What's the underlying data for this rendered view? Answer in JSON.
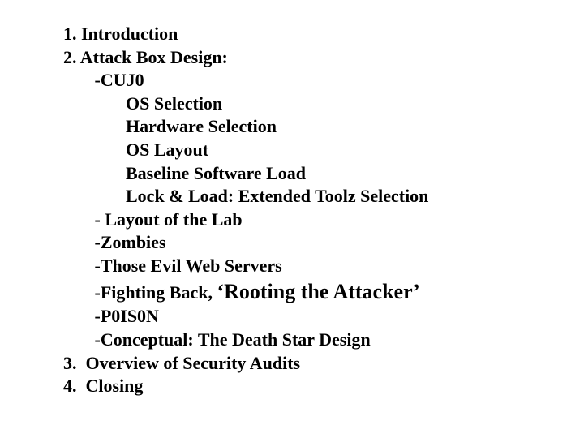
{
  "outline": {
    "item1": "1. Introduction",
    "item2": "2. Attack Box Design:",
    "cuj0": "-CUJ0",
    "os_selection": "OS Selection",
    "hardware_selection": "Hardware Selection",
    "os_layout": "OS Layout",
    "baseline_software_load": "Baseline Software Load",
    "lock_and_load": "Lock & Load: Extended Toolz Selection",
    "layout_lab": "- Layout of the Lab",
    "zombies": "-Zombies",
    "evil_web_servers": "-Those Evil Web Servers",
    "fighting_back_prefix": "-Fighting Back, ",
    "fighting_back_emph": "‘Rooting the Attacker’",
    "p0is0n": "-P0IS0N",
    "death_star": "-Conceptual: The Death Star Design",
    "item3": "3.  Overview of Security Audits",
    "item4": "4.  Closing"
  }
}
